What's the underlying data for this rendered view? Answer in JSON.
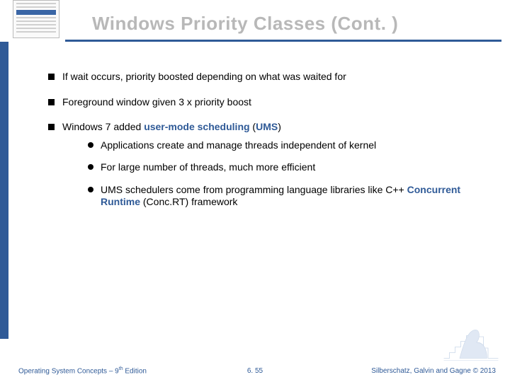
{
  "title": "Windows Priority Classes (Cont. )",
  "bullets": {
    "b1": "If wait occurs, priority boosted depending on what was waited for",
    "b2": "Foreground window given 3 x priority boost",
    "b3_pre": "Windows 7 added ",
    "b3_kw1": "user-mode scheduling",
    "b3_mid": " (",
    "b3_kw2": "UMS",
    "b3_post": ")",
    "s1": "Applications create and manage threads independent of kernel",
    "s2": "For large number of threads, much more efficient",
    "s3_pre": "UMS schedulers come from programming language libraries like C++ ",
    "s3_kw": "Concurrent Runtime",
    "s3_post": " (Conc.RT) framework"
  },
  "footer": {
    "left_pre": "Operating System Concepts – 9",
    "left_sup": "th",
    "left_post": " Edition",
    "center": "6. 55",
    "right": "Silberschatz, Galvin and Gagne © 2013"
  }
}
